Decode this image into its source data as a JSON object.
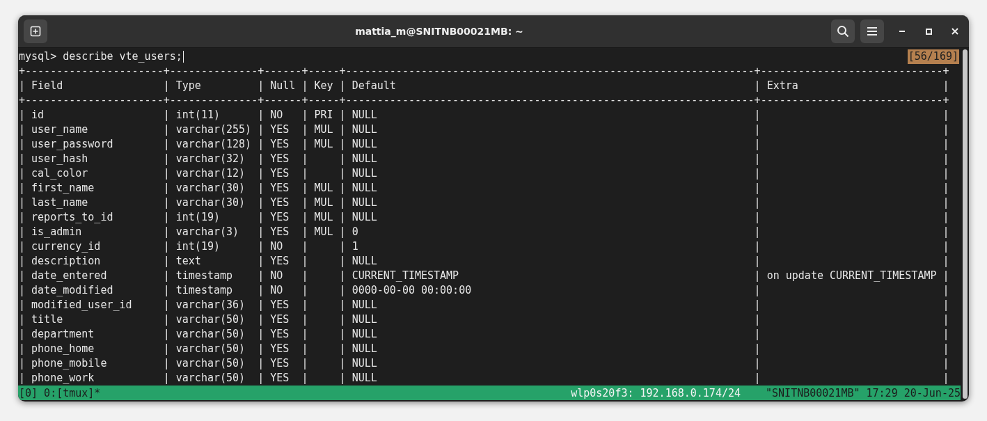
{
  "window": {
    "title": "mattia_m@SNITNB00021MB: ~"
  },
  "terminal": {
    "prompt_line": "mysql> describe vte_users;",
    "scroll_position": "[56/169]",
    "table": {
      "border": "+----------------------+--------------+------+-----+-----------------------------------------------------------------+-----------------------------+",
      "column_separator": "|",
      "columns": [
        "Field",
        "Type",
        "Null",
        "Key",
        "Default",
        "Extra"
      ],
      "rows": [
        [
          "id",
          "int(11)",
          "NO",
          "PRI",
          "NULL",
          ""
        ],
        [
          "user_name",
          "varchar(255)",
          "YES",
          "MUL",
          "NULL",
          ""
        ],
        [
          "user_password",
          "varchar(128)",
          "YES",
          "MUL",
          "NULL",
          ""
        ],
        [
          "user_hash",
          "varchar(32)",
          "YES",
          "",
          "NULL",
          ""
        ],
        [
          "cal_color",
          "varchar(12)",
          "YES",
          "",
          "NULL",
          ""
        ],
        [
          "first_name",
          "varchar(30)",
          "YES",
          "MUL",
          "NULL",
          ""
        ],
        [
          "last_name",
          "varchar(30)",
          "YES",
          "MUL",
          "NULL",
          ""
        ],
        [
          "reports_to_id",
          "int(19)",
          "YES",
          "MUL",
          "NULL",
          ""
        ],
        [
          "is_admin",
          "varchar(3)",
          "YES",
          "MUL",
          "0",
          ""
        ],
        [
          "currency_id",
          "int(19)",
          "NO",
          "",
          "1",
          ""
        ],
        [
          "description",
          "text",
          "YES",
          "",
          "NULL",
          ""
        ],
        [
          "date_entered",
          "timestamp",
          "NO",
          "",
          "CURRENT_TIMESTAMP",
          "on update CURRENT_TIMESTAMP"
        ],
        [
          "date_modified",
          "timestamp",
          "NO",
          "",
          "0000-00-00 00:00:00",
          ""
        ],
        [
          "modified_user_id",
          "varchar(36)",
          "YES",
          "",
          "NULL",
          ""
        ],
        [
          "title",
          "varchar(50)",
          "YES",
          "",
          "NULL",
          ""
        ],
        [
          "department",
          "varchar(50)",
          "YES",
          "",
          "NULL",
          ""
        ],
        [
          "phone_home",
          "varchar(50)",
          "YES",
          "",
          "NULL",
          ""
        ],
        [
          "phone_mobile",
          "varchar(50)",
          "YES",
          "",
          "NULL",
          ""
        ],
        [
          "phone_work",
          "varchar(50)",
          "YES",
          "",
          "NULL",
          ""
        ]
      ]
    }
  },
  "status_bar": {
    "session": "[0] 0:[tmux]*",
    "network": "wlp0s20f3: 192.168.0.174/24",
    "host_time": "\"SNITNB00021MB\" 17:29 20-Jun-25"
  }
}
